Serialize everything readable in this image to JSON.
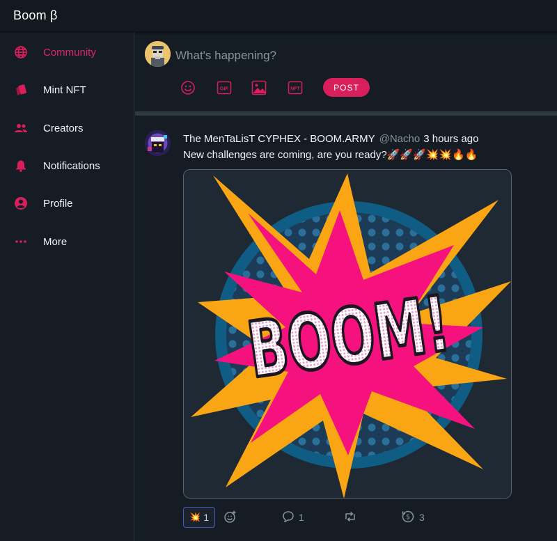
{
  "app": {
    "title": "Boom β"
  },
  "colors": {
    "accent": "#d81e5b",
    "background": "#151c24",
    "topbar": "#121920"
  },
  "sidebar": {
    "items": [
      {
        "label": "Community",
        "icon": "globe-icon",
        "active": true
      },
      {
        "label": "Mint NFT",
        "icon": "cards-icon",
        "active": false
      },
      {
        "label": "Creators",
        "icon": "people-icon",
        "active": false
      },
      {
        "label": "Notifications",
        "icon": "bell-icon",
        "active": false
      },
      {
        "label": "Profile",
        "icon": "profile-icon",
        "active": false
      },
      {
        "label": "More",
        "icon": "more-dots-icon",
        "active": false
      }
    ]
  },
  "compose": {
    "placeholder": "What's happening?",
    "tools": [
      "emoji-icon",
      "gif-icon",
      "image-icon",
      "nft-icon"
    ],
    "gif_label": "GIF",
    "nft_label": "NFT",
    "post_label": "POST"
  },
  "post": {
    "author": "The MenTaLisT CYPHEX - BOOM.ARMY",
    "handle": "@Nacho",
    "time": "3 hours ago",
    "text": "New challenges are coming, are you ready?🚀🚀🚀💥💥🔥🔥",
    "image_text": "BOOM!",
    "reaction_emoji": "💥",
    "reaction_count": "1",
    "comments": "1",
    "tips": "3"
  }
}
